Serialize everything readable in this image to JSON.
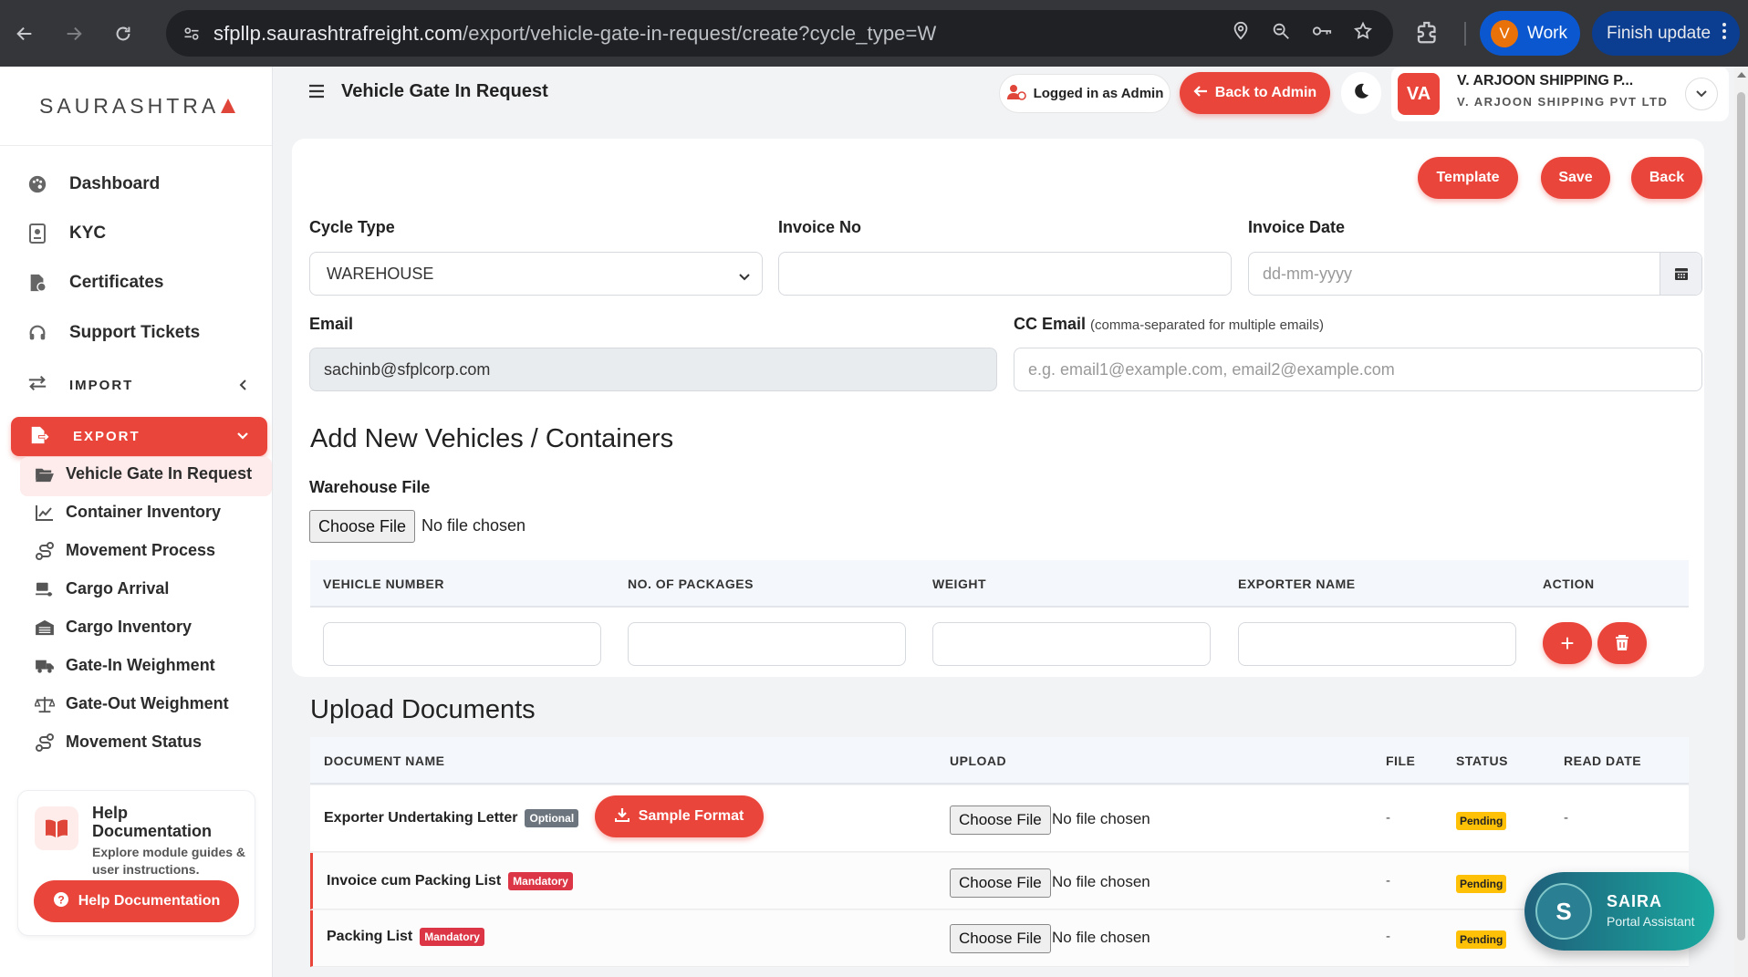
{
  "browser": {
    "url_host": "sfpllp.saurashtrafreight.com",
    "url_path": "/export/vehicle-gate-in-request/create?cycle_type=W",
    "profile_initial": "V",
    "profile_label": "Work",
    "update_label": "Finish update"
  },
  "sidebar": {
    "brand": "SAURASHTRA",
    "items": [
      {
        "label": "Dashboard",
        "icon": "palette-icon"
      },
      {
        "label": "KYC",
        "icon": "id-card-icon"
      },
      {
        "label": "Certificates",
        "icon": "file-icon"
      },
      {
        "label": "Support Tickets",
        "icon": "headset-icon"
      }
    ],
    "import_label": "IMPORT",
    "export_label": "EXPORT",
    "export_items": [
      {
        "label": "Vehicle Gate In Request",
        "icon": "folder-open-icon"
      },
      {
        "label": "Container Inventory",
        "icon": "chart-line-icon"
      },
      {
        "label": "Movement Process",
        "icon": "route-icon"
      },
      {
        "label": "Cargo Arrival",
        "icon": "truck-loading-icon"
      },
      {
        "label": "Cargo Inventory",
        "icon": "warehouse-icon"
      },
      {
        "label": "Gate-In Weighment",
        "icon": "truck-icon"
      },
      {
        "label": "Gate-Out Weighment",
        "icon": "scale-icon"
      },
      {
        "label": "Movement Status",
        "icon": "route-icon"
      }
    ],
    "help": {
      "title": "Help Documentation",
      "desc": "Explore module guides & user instructions.",
      "button": "Help Documentation"
    }
  },
  "topbar": {
    "title": "Vehicle Gate In Request",
    "logged_in": "Logged in as Admin",
    "back_admin": "Back to Admin",
    "company_initials": "VA",
    "company_name": "V. ARJOON SHIPPING P...",
    "company_sub": "V. ARJOON SHIPPING PVT LTD"
  },
  "form": {
    "template_btn": "Template",
    "save_btn": "Save",
    "back_btn": "Back",
    "cycle_type_label": "Cycle Type",
    "cycle_type_value": "WAREHOUSE",
    "invoice_no_label": "Invoice No",
    "invoice_no_value": "",
    "invoice_date_label": "Invoice Date",
    "invoice_date_placeholder": "dd-mm-yyyy",
    "email_label": "Email",
    "email_value": "sachinb@sfplcorp.com",
    "cc_email_label": "CC Email",
    "cc_email_hint": "(comma-separated for multiple emails)",
    "cc_email_placeholder": "e.g. email1@example.com, email2@example.com"
  },
  "vehicles": {
    "title": "Add New Vehicles / Containers",
    "file_label": "Warehouse File",
    "choose_file": "Choose File",
    "no_file": "No file chosen",
    "columns": [
      "VEHICLE NUMBER",
      "NO. OF PACKAGES",
      "WEIGHT",
      "EXPORTER NAME",
      "ACTION"
    ],
    "add_symbol": "+"
  },
  "documents": {
    "title": "Upload Documents",
    "columns": [
      "DOCUMENT NAME",
      "UPLOAD",
      "FILE",
      "STATUS",
      "READ DATE"
    ],
    "sample_format": "Sample Format",
    "rows": [
      {
        "name": "Exporter Undertaking Letter",
        "badge": "Optional",
        "file": "-",
        "status": "Pending",
        "read_date": "-"
      },
      {
        "name": "Invoice cum Packing List",
        "badge": "Mandatory",
        "file": "-",
        "status": "Pending",
        "read_date": ""
      },
      {
        "name": "Packing List",
        "badge": "Mandatory",
        "file": "-",
        "status": "Pending",
        "read_date": ""
      }
    ]
  },
  "assistant": {
    "initial": "S",
    "name": "SAIRA",
    "subtitle": "Portal Assistant"
  }
}
